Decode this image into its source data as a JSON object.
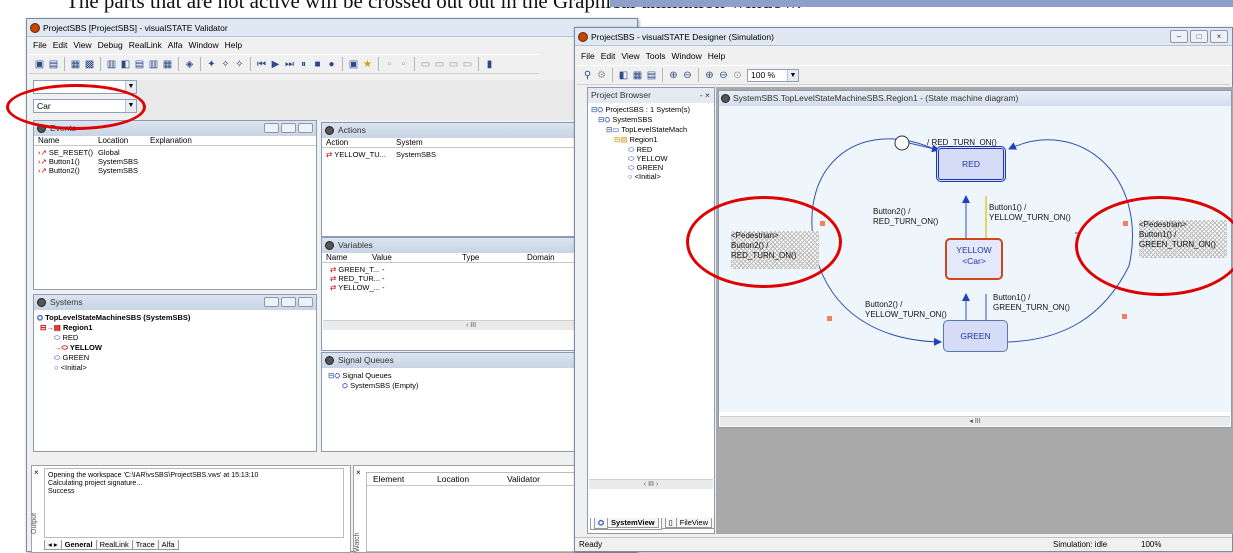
{
  "slide": {
    "header_text": "The parts that are not active will be crossed out out in the Graphical animation window."
  },
  "validator": {
    "title": "ProjectSBS [ProjectSBS] - visualSTATE Validator",
    "menu": [
      "File",
      "Edit",
      "View",
      "Debug",
      "RealLink",
      "Alfa",
      "Window",
      "Help"
    ],
    "combo_value": "Car",
    "sigma": "Σ",
    "events": {
      "title": "Events",
      "columns": [
        "Name",
        "Location",
        "Explanation"
      ],
      "rows": [
        {
          "name": "SE_RESET()",
          "location": "Global"
        },
        {
          "name": "Button1()",
          "location": "SystemSBS"
        },
        {
          "name": "Button2()",
          "location": "SystemSBS"
        }
      ]
    },
    "actions": {
      "title": "Actions",
      "columns": [
        "Action",
        "System"
      ],
      "rows": [
        {
          "name": "YELLOW_TU...",
          "system": "SystemSBS"
        }
      ]
    },
    "variables": {
      "title": "Variables",
      "columns": [
        "Name",
        "Value",
        "Type",
        "Domain"
      ],
      "rows": [
        {
          "name": "GREEN_T...",
          "value": "-"
        },
        {
          "name": "RED_TUR...",
          "value": "-"
        },
        {
          "name": "YELLOW_...",
          "value": "-"
        }
      ],
      "scroll_thumb": "III"
    },
    "systems": {
      "title": "Systems",
      "root": "TopLevelStateMachineSBS (SystemSBS)",
      "region": "Region1",
      "items": [
        "RED",
        "YELLOW",
        "GREEN",
        "<Initial>"
      ]
    },
    "signal_queues": {
      "title": "Signal Queues",
      "root": "Signal Queues",
      "child": "SystemSBS (Empty)"
    },
    "output": {
      "lines": [
        "Opening the workspace 'C:\\IAR\\vsSBS\\ProjectSBS.vws' at 15:13:10",
        "Calculating project signature...",
        "Success"
      ],
      "side_label": "Output",
      "tabs": [
        "General",
        "RealLink",
        "Trace",
        "Alfa"
      ]
    },
    "watch": {
      "columns": [
        "Element",
        "Location",
        "Validator"
      ],
      "side_label": "Watch"
    }
  },
  "designer": {
    "title": "ProjectSBS - visualSTATE Designer (Simulation)",
    "menu": [
      "File",
      "Edit",
      "View",
      "Tools",
      "Window",
      "Help"
    ],
    "zoom": "100 %",
    "browser": {
      "title": "Project Browser",
      "pin": "- ×",
      "items": [
        "ProjectSBS : 1 System(s)",
        "SystemSBS",
        "TopLevelStateMach",
        "Region1",
        "RED",
        "YELLOW",
        "GREEN",
        "<Initial>"
      ],
      "tabs": [
        "SystemView",
        "FileView"
      ],
      "scroll_thumb": "III"
    },
    "diagram": {
      "title": "SystemSBS.TopLevelStateMachineSBS.Region1 - (State machine diagram)",
      "states": {
        "red": "RED",
        "yellow": "YELLOW",
        "yellow_sub": "<Car>",
        "green": "GREEN"
      },
      "labels": {
        "initial": "/ RED_TURN_ON()",
        "b2_red_1": "Button2() /",
        "b2_red_2": "RED_TURN_ON()",
        "b1_yel_1": "Button1() /",
        "b1_yel_2": "YELLOW_TURN_ON()",
        "b2_yel_1": "Button2() /",
        "b2_yel_2": "YELLOW_TURN_ON()",
        "b1_grn_1": "Button1() /",
        "b1_grn_2": "GREEN_TURN_ON()"
      },
      "note_left": [
        "<Pedestrian>",
        "Button2() /",
        "RED_TURN_ON()"
      ],
      "note_right": [
        "<Pedestrian>",
        "Button1() /",
        "GREEN_TURN_ON()"
      ],
      "scroll_thumb": "III"
    },
    "status": {
      "left": "Ready",
      "sim": "Simulation: idle",
      "zoom": "100%"
    }
  },
  "colors": {
    "annotation_red": "#e00000",
    "state_fill": "#d6dcf6",
    "active_state_border": "#1f38b8",
    "yellow_border": "#d0451b"
  }
}
